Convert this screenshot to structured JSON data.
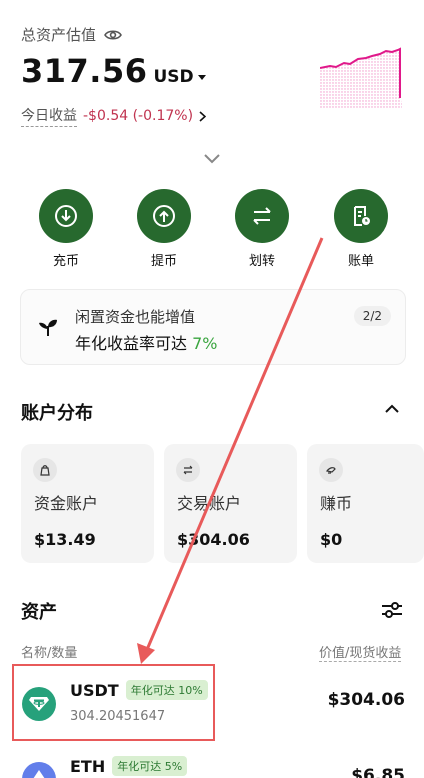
{
  "header": {
    "total_label": "总资产估值",
    "total_value": "317.56",
    "currency": "USD",
    "pnl_label": "今日收益",
    "pnl_value": "-$0.54 (-0.17%)"
  },
  "actions": [
    {
      "label": "充币",
      "icon": "deposit-icon"
    },
    {
      "label": "提币",
      "icon": "withdraw-icon"
    },
    {
      "label": "划转",
      "icon": "transfer-icon"
    },
    {
      "label": "账单",
      "icon": "bill-icon"
    }
  ],
  "promo": {
    "title": "闲置资金也能增值",
    "subtitle_prefix": "年化收益率可达 ",
    "subtitle_rate": "7%",
    "pager": "2/2"
  },
  "accounts": {
    "title": "账户分布",
    "items": [
      {
        "name": "资金账户",
        "amount": "$13.49",
        "icon": "wallet-icon"
      },
      {
        "name": "交易账户",
        "amount": "$304.06",
        "icon": "exchange-icon"
      },
      {
        "name": "赚币",
        "amount": "$0",
        "icon": "earn-icon"
      }
    ]
  },
  "assets": {
    "title": "资产",
    "col_left": "名称/数量",
    "col_right": "价值/现货收益",
    "rows": [
      {
        "symbol": "USDT",
        "badge": "年化可达 10%",
        "quantity": "304.20451647",
        "value": "$304.06"
      },
      {
        "symbol": "ETH",
        "badge": "年化可达 5%",
        "quantity": "",
        "value": "$6.85"
      }
    ]
  },
  "colors": {
    "accent_green": "#27692e",
    "negative": "#c0334f",
    "sparkline": "#e0188a",
    "annotation": "#e85a5a"
  }
}
